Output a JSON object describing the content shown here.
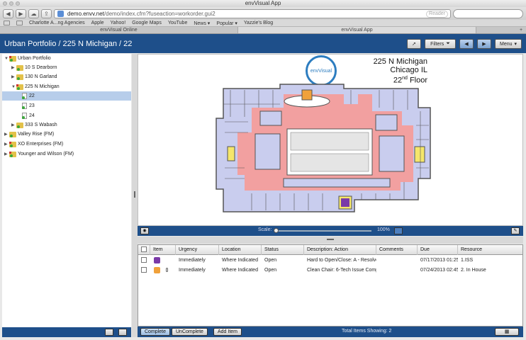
{
  "browser": {
    "window_title": "envVisual App",
    "url_host": "demo.envv.net",
    "url_path": "/demo/index.cfm?fuseaction=workorder.gui2",
    "reader_label": "Reader",
    "bookmarks": [
      "Charlotte A...ng Agencies",
      "Apple",
      "Yahoo!",
      "Google Maps",
      "YouTube",
      "News ▾",
      "Popular ▾",
      "Yazzie's Blog"
    ],
    "tabs": [
      "envVisual Online",
      "envVisual App"
    ]
  },
  "header": {
    "breadcrumb": "Urban Portfolio / 225 N Michigan / 22",
    "filters_label": "Filters",
    "menu_label": "Menu"
  },
  "tree": {
    "root": "Urban Portfolio",
    "buildings": [
      "10 S Dearborn",
      "130 N Garland",
      "225 N Michigan"
    ],
    "floors": [
      "22",
      "23",
      "24"
    ],
    "building_4": "333 S Wabash",
    "other_portfolios": [
      "Valley Rise (FM)",
      "XO Enterprises (FM)",
      "Younger and Wilson (FM)"
    ]
  },
  "floorplan": {
    "logo_text": "envVisual",
    "address": "225 N Michigan",
    "city": "Chicago IL",
    "floor_num": "22",
    "floor_suffix": "nd",
    "floor_word": "Floor",
    "colors": {
      "corridor": "#f2a0a0",
      "office": "#c9cdee",
      "wall": "#555555",
      "highlight_orange": "#f0a13a",
      "highlight_purple": "#7a3aa8",
      "highlight_yellow": "#f5e66b"
    }
  },
  "scale": {
    "label": "Scale:",
    "percent": "100%"
  },
  "table": {
    "columns": [
      "Item",
      "Urgency",
      "Location",
      "Status",
      "Description: Action",
      "Comments",
      "Due",
      "Resource"
    ],
    "rows": [
      {
        "urgency": "Immediately",
        "location": "Where Indicated",
        "status": "Open",
        "description": "Hard to Open/Close: A - Resolve",
        "comments": "",
        "due": "07/17/2013 01:25",
        "resource": "1.ISS",
        "icon_color": "#7a3aa8"
      },
      {
        "urgency": "Immediately",
        "location": "Where Indicated",
        "status": "Open",
        "description": "Clean Chair: 6-Tech Issue Comp",
        "comments": "",
        "due": "07/24/2013 02:45",
        "resource": "2. In House",
        "icon_color": "#f0a13a"
      }
    ]
  },
  "footer": {
    "complete_label": "Complete",
    "uncomplete_label": "UnComplete",
    "add_item_label": "Add Item",
    "total_label": "Total Items Showing:",
    "total_count": "2"
  }
}
